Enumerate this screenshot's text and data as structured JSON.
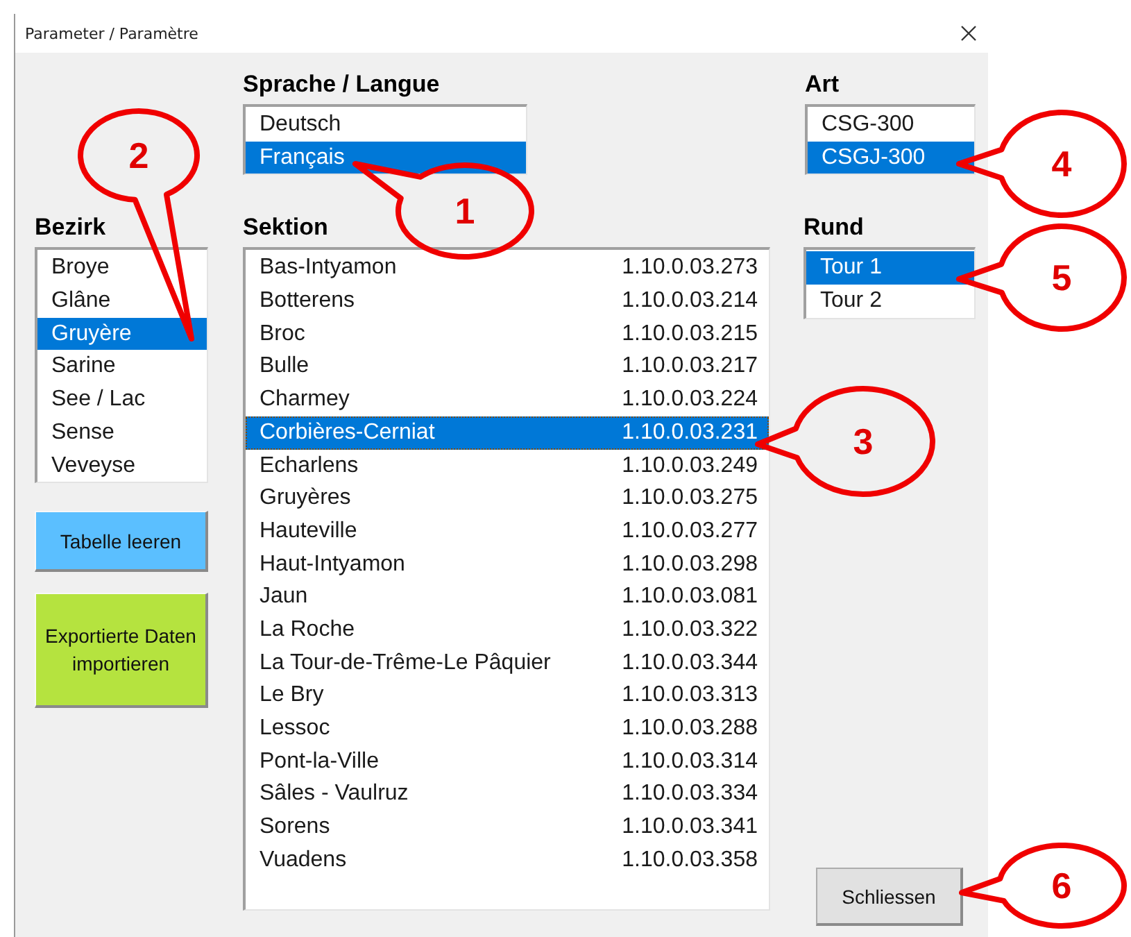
{
  "window": {
    "title": "Parameter / Paramètre"
  },
  "language": {
    "label": "Sprache / Langue",
    "items": [
      {
        "label": "Deutsch",
        "selected": false
      },
      {
        "label": "Français",
        "selected": true
      }
    ]
  },
  "art": {
    "label": "Art",
    "items": [
      {
        "label": "CSG-300",
        "selected": false
      },
      {
        "label": "CSGJ-300",
        "selected": true
      }
    ]
  },
  "district": {
    "label": "Bezirk",
    "items": [
      {
        "label": "Broye",
        "selected": false
      },
      {
        "label": "Glâne",
        "selected": false
      },
      {
        "label": "Gruyère",
        "selected": true
      },
      {
        "label": "Sarine",
        "selected": false
      },
      {
        "label": "See / Lac",
        "selected": false
      },
      {
        "label": "Sense",
        "selected": false
      },
      {
        "label": "Veveyse",
        "selected": false
      }
    ]
  },
  "section": {
    "label": "Sektion",
    "items": [
      {
        "label": "Bas-Intyamon",
        "code": "1.10.0.03.273",
        "selected": false
      },
      {
        "label": "Botterens",
        "code": "1.10.0.03.214",
        "selected": false
      },
      {
        "label": "Broc",
        "code": "1.10.0.03.215",
        "selected": false
      },
      {
        "label": "Bulle",
        "code": "1.10.0.03.217",
        "selected": false
      },
      {
        "label": "Charmey",
        "code": "1.10.0.03.224",
        "selected": false
      },
      {
        "label": "Corbières-Cerniat",
        "code": "1.10.0.03.231",
        "selected": true
      },
      {
        "label": "Echarlens",
        "code": "1.10.0.03.249",
        "selected": false
      },
      {
        "label": "Gruyères",
        "code": "1.10.0.03.275",
        "selected": false
      },
      {
        "label": "Hauteville",
        "code": "1.10.0.03.277",
        "selected": false
      },
      {
        "label": "Haut-Intyamon",
        "code": "1.10.0.03.298",
        "selected": false
      },
      {
        "label": "Jaun",
        "code": "1.10.0.03.081",
        "selected": false
      },
      {
        "label": "La Roche",
        "code": "1.10.0.03.322",
        "selected": false
      },
      {
        "label": "La Tour-de-Trême-Le Pâquier",
        "code": "1.10.0.03.344",
        "selected": false
      },
      {
        "label": "Le Bry",
        "code": "1.10.0.03.313",
        "selected": false
      },
      {
        "label": "Lessoc",
        "code": "1.10.0.03.288",
        "selected": false
      },
      {
        "label": "Pont-la-Ville",
        "code": "1.10.0.03.314",
        "selected": false
      },
      {
        "label": "Sâles - Vaulruz",
        "code": "1.10.0.03.334",
        "selected": false
      },
      {
        "label": "Sorens",
        "code": "1.10.0.03.341",
        "selected": false
      },
      {
        "label": "Vuadens",
        "code": "1.10.0.03.358",
        "selected": false
      }
    ]
  },
  "round": {
    "label": "Rund",
    "items": [
      {
        "label": "Tour 1",
        "selected": true
      },
      {
        "label": "Tour 2",
        "selected": false
      }
    ]
  },
  "action_buttons": [
    {
      "label": "Tabelle leeren",
      "color": "#5bbfff"
    },
    {
      "label": "Exportierte Daten importieren",
      "color": "#b5e33f"
    }
  ],
  "close_button": {
    "label": "Schliessen"
  },
  "annotations": [
    {
      "label": "1"
    },
    {
      "label": "2"
    },
    {
      "label": "3"
    },
    {
      "label": "4"
    },
    {
      "label": "5"
    },
    {
      "label": "6"
    }
  ]
}
